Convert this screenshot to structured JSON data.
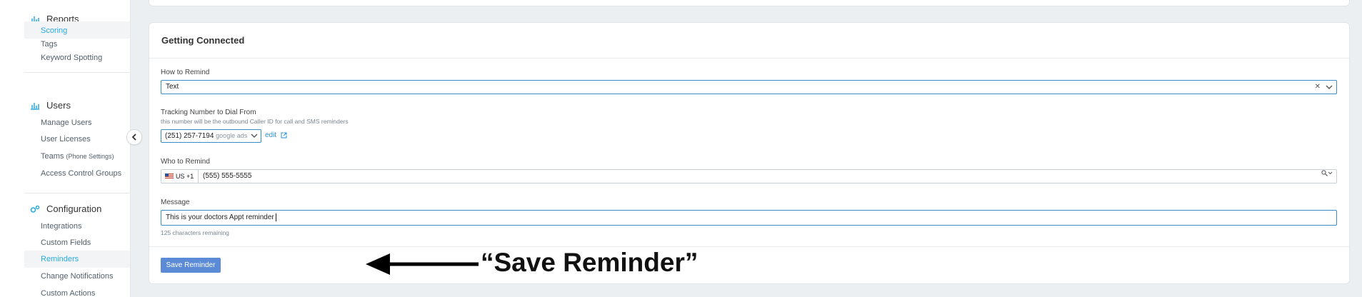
{
  "sidebar": {
    "reports": {
      "title": "Reports",
      "items": [
        "Scoring",
        "Tags",
        "Keyword Spotting"
      ]
    },
    "users": {
      "title": "Users",
      "items": [
        "Manage Users",
        "User Licenses",
        "Teams",
        "Access Control Groups"
      ],
      "teams_suffix": "(Phone Settings)"
    },
    "configuration": {
      "title": "Configuration",
      "items": [
        "Integrations",
        "Custom Fields",
        "Reminders",
        "Change Notifications",
        "Custom Actions"
      ]
    },
    "active_item": "Reminders",
    "accent_color": "#29abe2"
  },
  "form": {
    "title": "Getting Connected",
    "how_to_remind": {
      "label": "How to Remind",
      "value": "Text",
      "clear_icon": "close-icon"
    },
    "tracking": {
      "label": "Tracking Number to Dial From",
      "hint": "this number will be the outbound Caller ID for call and SMS reminders",
      "number": "(251) 257-7194",
      "source": "google ads",
      "edit_label": "edit"
    },
    "who_to_remind": {
      "label": "Who to Remind",
      "country": "US +1",
      "phone": "(555) 555-5555"
    },
    "message": {
      "label": "Message",
      "value": "This is your doctors Appt reminder",
      "remaining": "125 characters remaining"
    },
    "save_label": "Save Reminder"
  },
  "annotation": {
    "text": "“Save Reminder”"
  },
  "colors": {
    "primary_button": "#5b8ad6",
    "focus_border": "#3b8cc7",
    "link": "#2a8fd6"
  }
}
